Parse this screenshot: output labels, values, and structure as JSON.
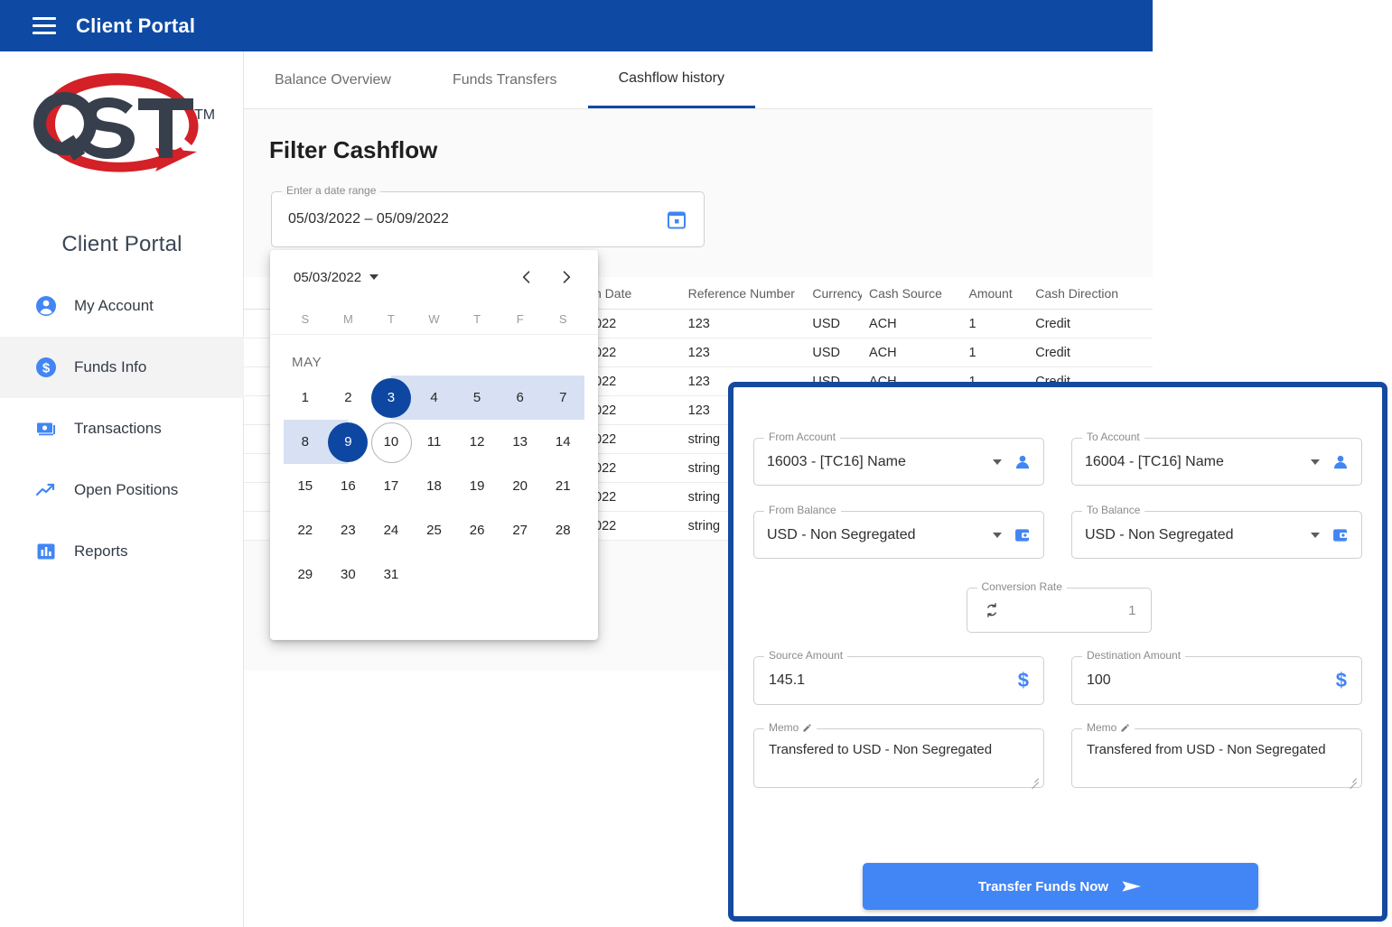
{
  "appbar": {
    "title": "Client Portal",
    "menu_icon": "hamburger-menu-icon"
  },
  "sidebar": {
    "logo_text": "QST",
    "logo_tm": "TM",
    "logo_caption": "Client Portal",
    "items": [
      {
        "label": "My Account",
        "icon": "account-circle-icon",
        "active": false
      },
      {
        "label": "Funds Info",
        "icon": "dollar-circle-icon",
        "active": true
      },
      {
        "label": "Transactions",
        "icon": "money-bill-icon",
        "active": false
      },
      {
        "label": "Open Positions",
        "icon": "trending-up-icon",
        "active": false
      },
      {
        "label": "Reports",
        "icon": "bar-chart-icon",
        "active": false
      }
    ]
  },
  "tabs": [
    {
      "label": "Balance Overview",
      "active": false
    },
    {
      "label": "Funds Transfers",
      "active": false
    },
    {
      "label": "Cashflow history",
      "active": true
    }
  ],
  "filter": {
    "title": "Filter Cashflow",
    "date_range_label": "Enter a date range",
    "date_range_value": "05/03/2022 – 05/09/2022",
    "calendar_icon": "calendar-icon"
  },
  "calendar": {
    "header_label": "05/03/2022",
    "prev_icon": "chevron-left-icon",
    "next_icon": "chevron-right-icon",
    "dropdown_icon": "chevron-down-icon",
    "dow": [
      "S",
      "M",
      "T",
      "W",
      "T",
      "F",
      "S"
    ],
    "month_label": "MAY",
    "weeks": [
      [
        "1",
        "2",
        "3",
        "4",
        "5",
        "6",
        "7"
      ],
      [
        "8",
        "9",
        "10",
        "11",
        "12",
        "13",
        "14"
      ],
      [
        "15",
        "16",
        "17",
        "18",
        "19",
        "20",
        "21"
      ],
      [
        "22",
        "23",
        "24",
        "25",
        "26",
        "27",
        "28"
      ],
      [
        "29",
        "30",
        "31",
        "",
        "",
        "",
        ""
      ]
    ],
    "selected_start": "3",
    "selected_end": "9",
    "today": "10",
    "accent": "#0d47a1",
    "range_bg": "#d7e1f3"
  },
  "table": {
    "columns": [
      "n Date",
      "Reference Number",
      "Currency",
      "Cash Source",
      "Amount",
      "Cash Direction"
    ],
    "rows": [
      {
        "date": "022",
        "ref": "123",
        "currency": "USD",
        "source": "ACH",
        "amount": "1",
        "direction": "Credit"
      },
      {
        "date": "022",
        "ref": "123",
        "currency": "USD",
        "source": "ACH",
        "amount": "1",
        "direction": "Credit"
      },
      {
        "date": "022",
        "ref": "123",
        "currency": "USD",
        "source": "ACH",
        "amount": "1",
        "direction": "Credit"
      },
      {
        "date": "022",
        "ref": "123",
        "currency": "",
        "source": "",
        "amount": "",
        "direction": ""
      },
      {
        "date": "022",
        "ref": "string",
        "currency": "",
        "source": "",
        "amount": "",
        "direction": ""
      },
      {
        "date": "022",
        "ref": "string",
        "currency": "",
        "source": "",
        "amount": "",
        "direction": ""
      },
      {
        "date": "022",
        "ref": "string",
        "currency": "",
        "source": "",
        "amount": "",
        "direction": ""
      },
      {
        "date": "022",
        "ref": "string",
        "currency": "",
        "source": "",
        "amount": "",
        "direction": ""
      }
    ]
  },
  "dialog": {
    "border_color": "#154a9e",
    "from_account": {
      "label": "From Account",
      "value": "16003 - [TC16]  Name",
      "icon": "person-icon"
    },
    "to_account": {
      "label": "To Account",
      "value": "16004 - [TC16]  Name",
      "icon": "person-icon"
    },
    "from_balance": {
      "label": "From Balance",
      "value": "USD - Non Segregated",
      "icon": "wallet-icon"
    },
    "to_balance": {
      "label": "To Balance",
      "value": "USD - Non Segregated",
      "icon": "wallet-icon"
    },
    "conversion_rate": {
      "label": "Conversion Rate",
      "value": "1",
      "icon": "swap-refresh-icon"
    },
    "source_amount": {
      "label": "Source Amount",
      "value": "145.1",
      "icon": "dollar-sign-icon"
    },
    "destination_amount": {
      "label": "Destination Amount",
      "value": "100",
      "icon": "dollar-sign-icon"
    },
    "memo_from": {
      "label": "Memo",
      "edit_icon": "pencil-icon",
      "value": "Transfered to USD - Non Segregated"
    },
    "memo_to": {
      "label": "Memo",
      "edit_icon": "pencil-icon",
      "value": "Transfered from USD - Non Segregated"
    },
    "submit": {
      "label": "Transfer Funds Now",
      "icon": "send-arrow-icon",
      "color": "#4285f4"
    }
  }
}
